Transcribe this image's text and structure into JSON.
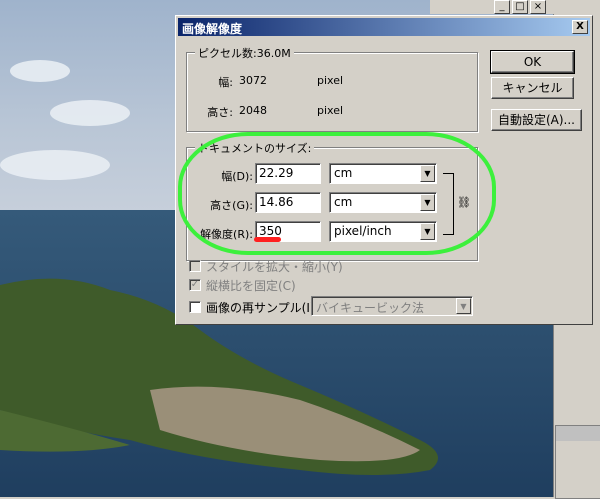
{
  "dialog": {
    "title": "画像解像度",
    "close_label": "X",
    "pixel_dimensions": {
      "header": "ピクセル数:36.0M",
      "width_label": "幅:",
      "width_value": "3072",
      "width_unit": "pixel",
      "height_label": "高さ:",
      "height_value": "2048",
      "height_unit": "pixel"
    },
    "document_size": {
      "header": "ドキュメントのサイズ:",
      "width_label": "幅(D):",
      "width_value": "22.29",
      "width_unit": "cm",
      "height_label": "高さ(G):",
      "height_value": "14.86",
      "height_unit": "cm",
      "resolution_label": "解像度(R):",
      "resolution_value": "350",
      "resolution_unit": "pixel/inch"
    },
    "options": {
      "scale_styles": "スタイルを拡大・縮小(Y)",
      "constrain_proportions": "縦横比を固定(C)",
      "resample": "画像の再サンプル(I):",
      "resample_method": "バイキュービック法"
    },
    "buttons": {
      "ok": "OK",
      "cancel": "キャンセル",
      "auto": "自動設定(A)..."
    }
  },
  "annotation_colors": {
    "highlight": "#3cf03c",
    "underline": "#ff2020"
  }
}
